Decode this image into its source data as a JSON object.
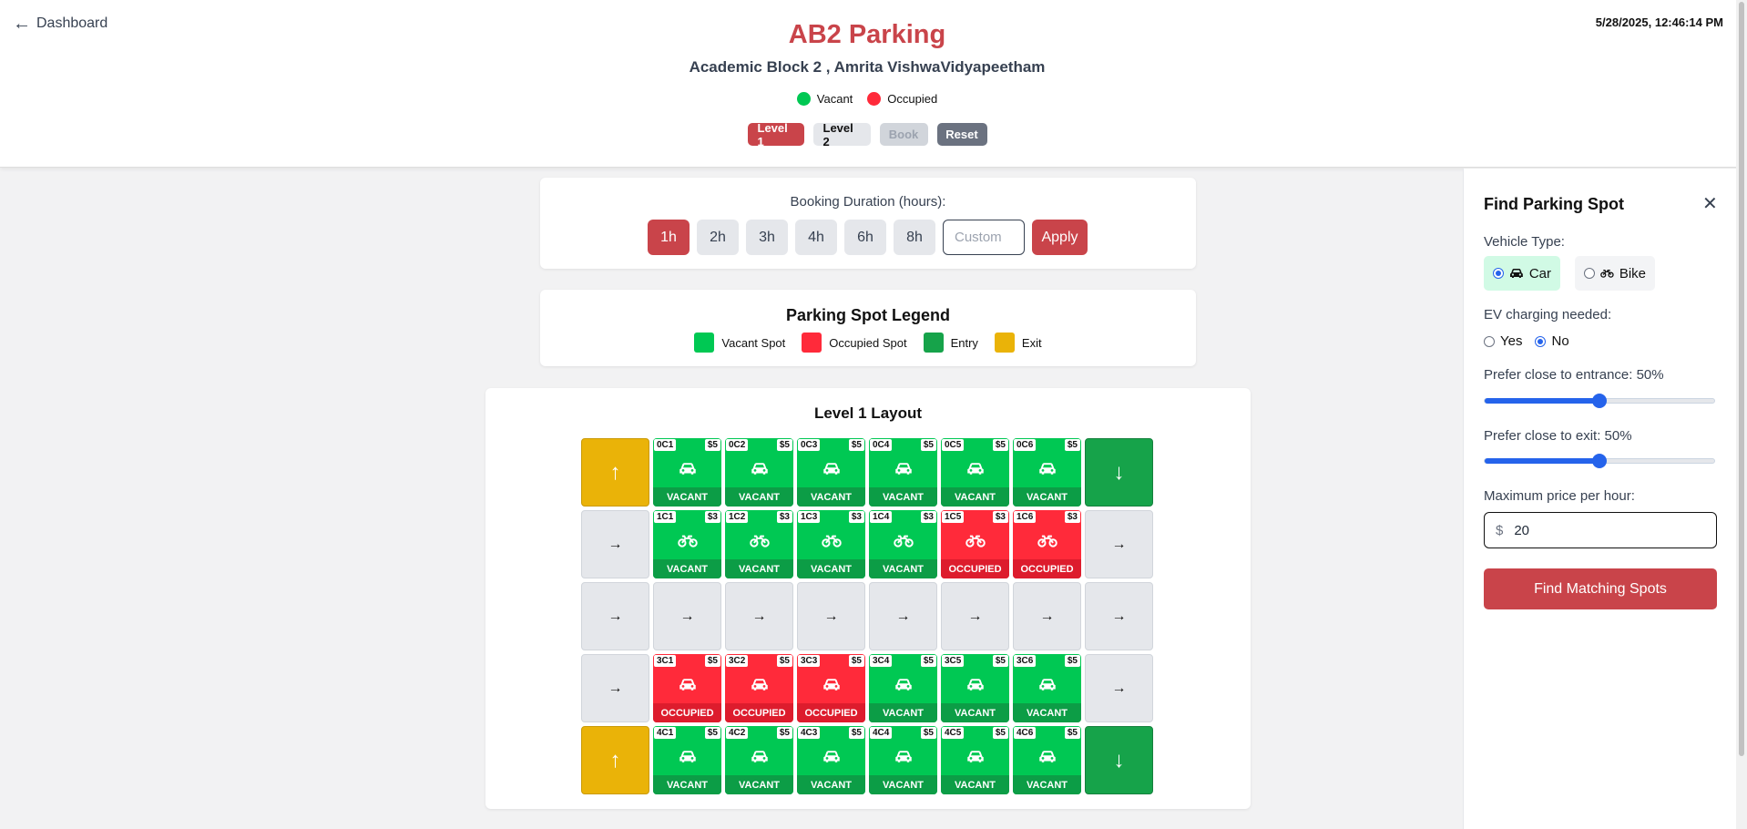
{
  "header": {
    "back_label": "Dashboard",
    "datetime": "5/28/2025, 12:46:14 PM",
    "title": "AB2 Parking",
    "subtitle": "Academic Block 2 , Amrita VishwaVidyapeetham",
    "status_legend": {
      "vacant": "Vacant",
      "occupied": "Occupied"
    },
    "buttons": {
      "level1": "Level 1",
      "level2": "Level 2",
      "book": "Book",
      "reset": "Reset"
    }
  },
  "duration": {
    "label": "Booking Duration (hours):",
    "options": [
      "1h",
      "2h",
      "3h",
      "4h",
      "6h",
      "8h"
    ],
    "selected": "1h",
    "custom_placeholder": "Custom",
    "apply_label": "Apply"
  },
  "legend": {
    "title": "Parking Spot Legend",
    "items": [
      {
        "label": "Vacant Spot",
        "color": "#00c853"
      },
      {
        "label": "Occupied Spot",
        "color": "#ff2a3a"
      },
      {
        "label": "Entry",
        "color": "#16a34a"
      },
      {
        "label": "Exit",
        "color": "#eab308"
      }
    ]
  },
  "layout": {
    "title": "Level 1 Layout",
    "rows": [
      [
        {
          "type": "exit",
          "icon": "up-arrow"
        },
        {
          "type": "spot",
          "id": "0C1",
          "price": "$5",
          "vehicle": "car",
          "status": "VACANT"
        },
        {
          "type": "spot",
          "id": "0C2",
          "price": "$5",
          "vehicle": "car",
          "status": "VACANT"
        },
        {
          "type": "spot",
          "id": "0C3",
          "price": "$5",
          "vehicle": "car",
          "status": "VACANT"
        },
        {
          "type": "spot",
          "id": "0C4",
          "price": "$5",
          "vehicle": "car",
          "status": "VACANT"
        },
        {
          "type": "spot",
          "id": "0C5",
          "price": "$5",
          "vehicle": "car",
          "status": "VACANT"
        },
        {
          "type": "spot",
          "id": "0C6",
          "price": "$5",
          "vehicle": "car",
          "status": "VACANT"
        },
        {
          "type": "entry",
          "icon": "down-arrow"
        }
      ],
      [
        {
          "type": "road",
          "icon": "right-arrow"
        },
        {
          "type": "spot",
          "id": "1C1",
          "price": "$3",
          "vehicle": "bike",
          "status": "VACANT"
        },
        {
          "type": "spot",
          "id": "1C2",
          "price": "$3",
          "vehicle": "bike",
          "status": "VACANT"
        },
        {
          "type": "spot",
          "id": "1C3",
          "price": "$3",
          "vehicle": "bike",
          "status": "VACANT"
        },
        {
          "type": "spot",
          "id": "1C4",
          "price": "$3",
          "vehicle": "bike",
          "status": "VACANT"
        },
        {
          "type": "spot",
          "id": "1C5",
          "price": "$3",
          "vehicle": "bike",
          "status": "OCCUPIED"
        },
        {
          "type": "spot",
          "id": "1C6",
          "price": "$3",
          "vehicle": "bike",
          "status": "OCCUPIED"
        },
        {
          "type": "road",
          "icon": "right-arrow"
        }
      ],
      [
        {
          "type": "road",
          "icon": "right-arrow"
        },
        {
          "type": "road",
          "icon": "right-arrow"
        },
        {
          "type": "road",
          "icon": "right-arrow"
        },
        {
          "type": "road",
          "icon": "right-arrow"
        },
        {
          "type": "road",
          "icon": "right-arrow"
        },
        {
          "type": "road",
          "icon": "right-arrow"
        },
        {
          "type": "road",
          "icon": "right-arrow"
        },
        {
          "type": "road",
          "icon": "right-arrow"
        }
      ],
      [
        {
          "type": "road",
          "icon": "right-arrow"
        },
        {
          "type": "spot",
          "id": "3C1",
          "price": "$5",
          "vehicle": "car",
          "status": "OCCUPIED"
        },
        {
          "type": "spot",
          "id": "3C2",
          "price": "$5",
          "vehicle": "car",
          "status": "OCCUPIED"
        },
        {
          "type": "spot",
          "id": "3C3",
          "price": "$5",
          "vehicle": "car",
          "status": "OCCUPIED"
        },
        {
          "type": "spot",
          "id": "3C4",
          "price": "$5",
          "vehicle": "car",
          "status": "VACANT"
        },
        {
          "type": "spot",
          "id": "3C5",
          "price": "$5",
          "vehicle": "car",
          "status": "VACANT"
        },
        {
          "type": "spot",
          "id": "3C6",
          "price": "$5",
          "vehicle": "car",
          "status": "VACANT"
        },
        {
          "type": "road",
          "icon": "right-arrow"
        }
      ],
      [
        {
          "type": "exit",
          "icon": "up-arrow"
        },
        {
          "type": "spot",
          "id": "4C1",
          "price": "$5",
          "vehicle": "car",
          "status": "VACANT"
        },
        {
          "type": "spot",
          "id": "4C2",
          "price": "$5",
          "vehicle": "car",
          "status": "VACANT"
        },
        {
          "type": "spot",
          "id": "4C3",
          "price": "$5",
          "vehicle": "car",
          "status": "VACANT"
        },
        {
          "type": "spot",
          "id": "4C4",
          "price": "$5",
          "vehicle": "car",
          "status": "VACANT"
        },
        {
          "type": "spot",
          "id": "4C5",
          "price": "$5",
          "vehicle": "car",
          "status": "VACANT"
        },
        {
          "type": "spot",
          "id": "4C6",
          "price": "$5",
          "vehicle": "car",
          "status": "VACANT"
        },
        {
          "type": "entry",
          "icon": "down-arrow"
        }
      ]
    ]
  },
  "sidebar": {
    "title": "Find Parking Spot",
    "vehicle_type_label": "Vehicle Type:",
    "vehicle_options": {
      "car": "Car",
      "bike": "Bike"
    },
    "selected_vehicle": "car",
    "ev_label": "EV charging needed:",
    "ev_options": {
      "yes": "Yes",
      "no": "No"
    },
    "ev_selected": "no",
    "entrance_label": "Prefer close to entrance: 50%",
    "entrance_value": 50,
    "exit_label": "Prefer close to exit: 50%",
    "exit_value": 50,
    "max_price_label": "Maximum price per hour:",
    "currency_symbol": "$",
    "max_price_value": "20",
    "find_button_label": "Find Matching Spots"
  },
  "colors": {
    "primary": "#c9444a",
    "vacant": "#00c853",
    "occupied": "#ff2a3a",
    "entry": "#16a34a",
    "exit": "#eab308",
    "slider": "#2563eb"
  }
}
